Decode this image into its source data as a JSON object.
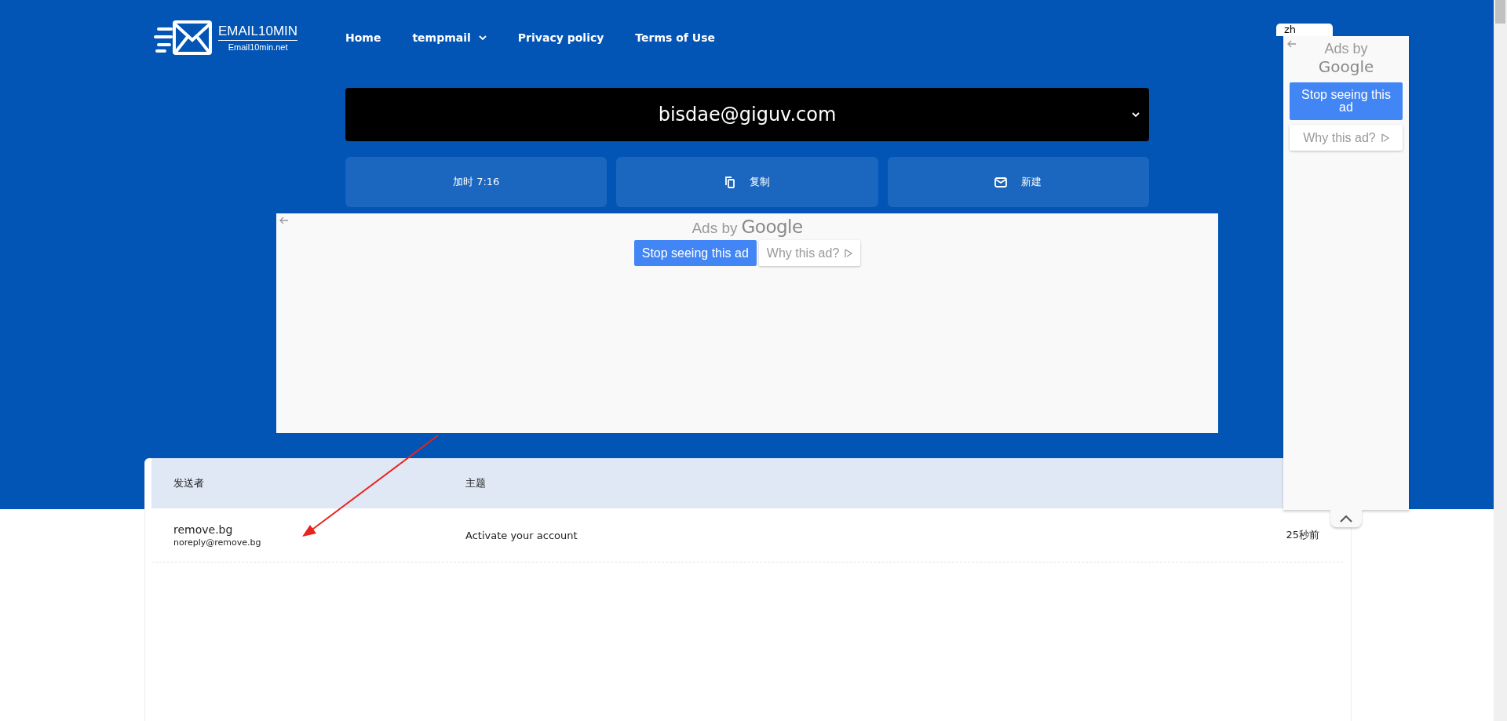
{
  "logo": {
    "title": "EMAIL10MIN",
    "subtitle": "Email10min.net"
  },
  "nav": [
    {
      "label": "Home",
      "dropdown": false
    },
    {
      "label": "tempmail",
      "dropdown": true
    },
    {
      "label": "Privacy policy",
      "dropdown": false
    },
    {
      "label": "Terms of Use",
      "dropdown": false
    }
  ],
  "language_button": {
    "label": "zh"
  },
  "address": {
    "value": "bisdae@giguv.com"
  },
  "actions": [
    {
      "label": "加时 7:16",
      "kind": "extend"
    },
    {
      "label": "复制",
      "kind": "copy"
    },
    {
      "label": "新建",
      "kind": "new"
    }
  ],
  "ad_banner": {
    "ads_by": "Ads by",
    "brand": "Google",
    "stop_button": "Stop seeing this ad",
    "why_button": "Why this ad?"
  },
  "side_ad": {
    "ads_by": "Ads by",
    "brand": "Google",
    "stop_button": "Stop seeing this ad",
    "why_button": "Why this ad?"
  },
  "inbox": {
    "columns": [
      "发送者",
      "主题"
    ],
    "rows": [
      {
        "sender_name": "remove.bg",
        "sender_email": "noreply@remove.bg",
        "subject": "Activate your account",
        "time": "25秒前"
      }
    ]
  }
}
